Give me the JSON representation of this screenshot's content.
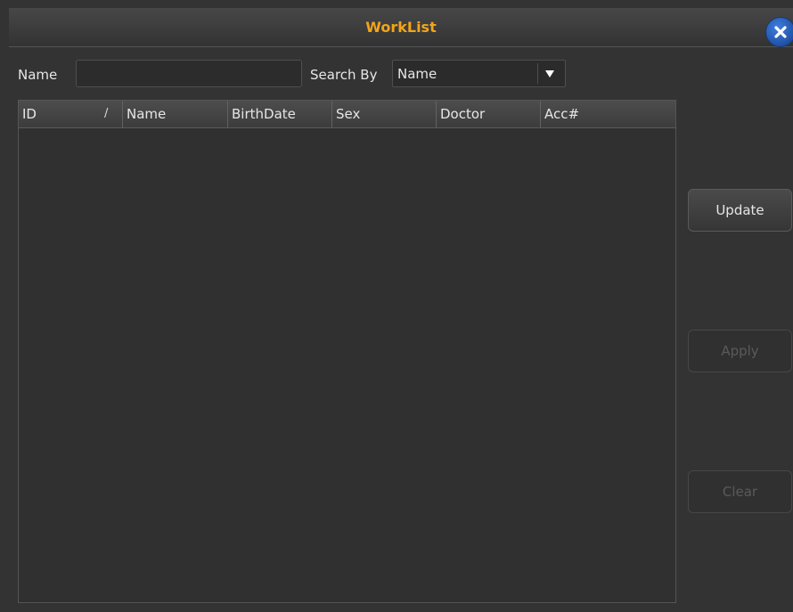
{
  "window": {
    "title": "WorkList",
    "close_icon": "close-icon",
    "accent": "#f2a51a"
  },
  "search": {
    "name_label": "Name",
    "name_value": "",
    "search_by_label": "Search By",
    "search_by_value": "Name",
    "dropdown_icon": "chevron-down-icon"
  },
  "table": {
    "columns": [
      "ID",
      "Name",
      "BirthDate",
      "Sex",
      "Doctor",
      "Acc#"
    ],
    "sort_marker": "/",
    "rows": []
  },
  "actions": {
    "update_label": "Update",
    "apply_label": "Apply",
    "clear_label": "Clear"
  }
}
